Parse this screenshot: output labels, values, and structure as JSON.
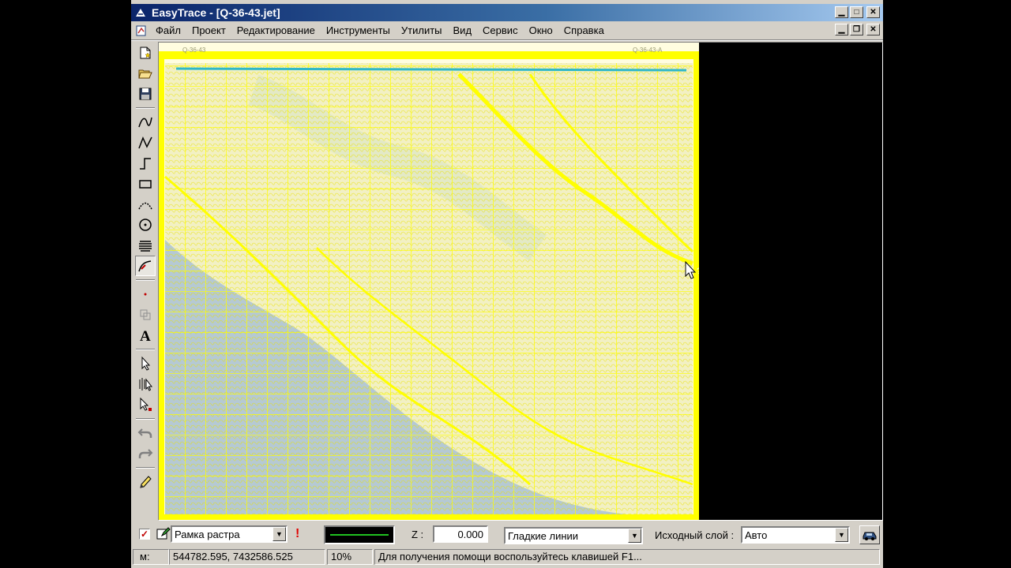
{
  "window": {
    "title": "EasyTrace - [Q-36-43.jet]",
    "buttons": {
      "minimize": "▁",
      "maximize": "□",
      "close": "✕"
    },
    "mdi_buttons": {
      "minimize": "▁",
      "restore": "❐",
      "close": "✕"
    }
  },
  "menu": [
    "Файл",
    "Проект",
    "Редактирование",
    "Инструменты",
    "Утилиты",
    "Вид",
    "Сервис",
    "Окно",
    "Справка"
  ],
  "toolbar": {
    "tools": [
      {
        "icon": "new-file-icon"
      },
      {
        "icon": "open-folder-icon"
      },
      {
        "icon": "save-icon"
      },
      {
        "icon": "curve-icon"
      },
      {
        "icon": "polyline-icon"
      },
      {
        "icon": "step-line-icon"
      },
      {
        "icon": "rectangle-icon"
      },
      {
        "icon": "arc-icon"
      },
      {
        "icon": "circle-icon"
      },
      {
        "icon": "hatch-icon"
      },
      {
        "icon": "trace-icon",
        "active": true
      },
      {
        "icon": "point-icon"
      },
      {
        "icon": "copy-objects-icon"
      },
      {
        "icon": "text-icon"
      },
      {
        "icon": "select-arrow-icon"
      },
      {
        "icon": "select-multiple-icon"
      },
      {
        "icon": "select-point-icon"
      },
      {
        "icon": "undo-icon"
      },
      {
        "icon": "redo-icon"
      },
      {
        "icon": "pencil-icon"
      }
    ]
  },
  "map": {
    "header_left": "Q-36-43",
    "header_right": "Q-36-43-А",
    "line_color": "#ffff00",
    "water_color": "#b5c9d4",
    "land_color": "#f2f0c4"
  },
  "status": {
    "layer_checkbox": true,
    "layer_name": "Рамка растра",
    "warning": "!",
    "z_label": "Z :",
    "z_value": "0.000",
    "line_mode": "Гладкие линии",
    "source_layer_label": "Исходный слой :",
    "source_layer_value": "Авто",
    "coord_label": "м:",
    "coordinates": "544782.595, 7432586.525",
    "zoom": "10%",
    "help_text": "Для получения помощи воспользуйтесь клавишей F1..."
  }
}
